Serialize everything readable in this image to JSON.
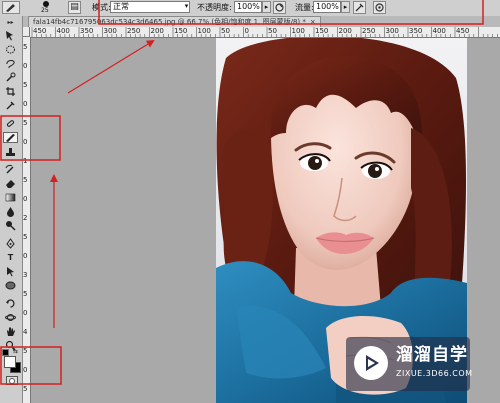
{
  "options_bar": {
    "brush_size": "25",
    "mode_label": "模式:",
    "mode_value": "正常",
    "opacity_label": "不透明度:",
    "opacity_value": "100%",
    "flow_label": "流量:",
    "flow_value": "100%"
  },
  "document_tab": {
    "title": "fala14fb4c716795063dc534c3d6465.jpg @ 66.7% (色相/饱和度 1, 图层蒙版/8) *",
    "close": "×"
  },
  "ruler_top": [
    "450",
    "400",
    "350",
    "300",
    "250",
    "200",
    "150",
    "100",
    "50",
    "0",
    "50",
    "100",
    "150",
    "200",
    "250",
    "300",
    "350",
    "400",
    "450"
  ],
  "ruler_left": [
    "5",
    "0",
    "5",
    "0",
    "5",
    "0",
    "1",
    "5",
    "0",
    "2",
    "5",
    "0",
    "3",
    "5",
    "0",
    "4",
    "5",
    "0",
    "5"
  ],
  "watermark": {
    "title": "溜溜自学",
    "url": "ZIXUE.3D66.COM"
  },
  "colors": {
    "annotation": "#d42020",
    "watermark_bg": "#232d46"
  }
}
